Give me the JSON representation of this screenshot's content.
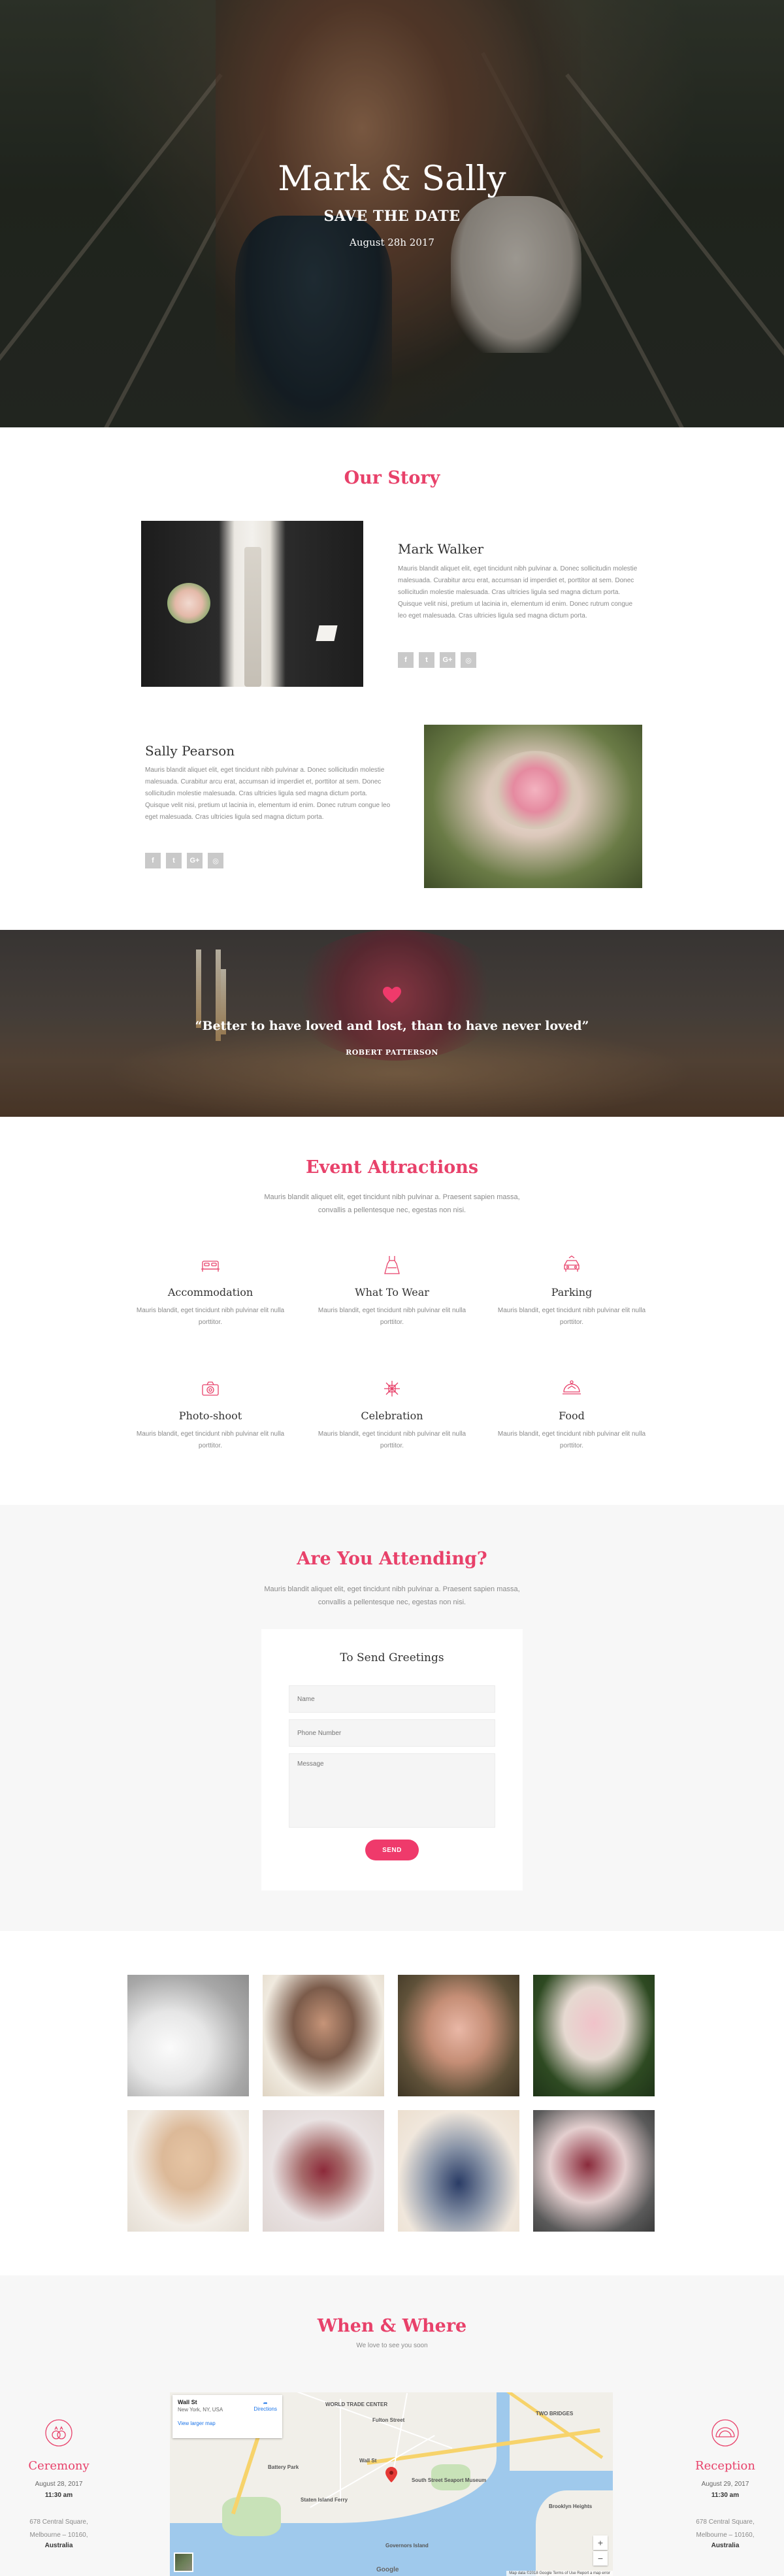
{
  "hero": {
    "names": "Mark & Sally",
    "subtitle": "SAVE THE DATE",
    "date": "August 28h 2017"
  },
  "story": {
    "title": "Our Story",
    "groom": {
      "name": "Mark Walker",
      "bio": "Mauris blandit aliquet elit, eget tincidunt nibh pulvinar a. Donec sollicitudin molestie malesuada. Curabitur arcu erat, accumsan id imperdiet et, porttitor at sem. Donec sollicitudin molestie malesuada. Cras ultricies ligula sed magna dictum porta. Quisque velit nisi, pretium ut lacinia in, elementum id enim. Donec rutrum congue leo eget malesuada. Cras ultricies ligula sed magna dictum porta."
    },
    "bride": {
      "name": "Sally Pearson",
      "bio": "Mauris blandit aliquet elit, eget tincidunt nibh pulvinar a. Donec sollicitudin molestie malesuada. Curabitur arcu erat, accumsan id imperdiet et, porttitor at sem. Donec sollicitudin molestie malesuada. Cras ultricies ligula sed magna dictum porta. Quisque velit nisi, pretium ut lacinia in, elementum id enim. Donec rutrum congue leo eget malesuada. Cras ultricies ligula sed magna dictum porta."
    },
    "social_icons": [
      "facebook-icon",
      "twitter-icon",
      "google-plus-icon",
      "instagram-icon"
    ],
    "social_glyphs": [
      "f",
      "t",
      "G+",
      "◎"
    ]
  },
  "quote": {
    "text": "“Better to have loved and lost, than to have never loved”",
    "author": "ROBERT PATTERSON"
  },
  "attractions": {
    "title": "Event Attractions",
    "description": "Mauris blandit aliquet elit, eget tincidunt nibh pulvinar a. Praesent sapien massa, convallis a pellentesque nec, egestas non nisi.",
    "items": [
      {
        "name": "Accommodation",
        "icon": "bed-icon",
        "desc": "Mauris blandit, eget tincidunt nibh pulvinar elit nulla porttitor."
      },
      {
        "name": "What To Wear",
        "icon": "dress-icon",
        "desc": "Mauris blandit, eget tincidunt nibh pulvinar elit nulla porttitor."
      },
      {
        "name": "Parking",
        "icon": "car-icon",
        "desc": "Mauris blandit, eget tincidunt nibh pulvinar elit nulla porttitor."
      },
      {
        "name": "Photo-shoot",
        "icon": "camera-icon",
        "desc": "Mauris blandit, eget tincidunt nibh pulvinar elit nulla porttitor."
      },
      {
        "name": "Celebration",
        "icon": "fireworks-icon",
        "desc": "Mauris blandit, eget tincidunt nibh pulvinar elit nulla porttitor."
      },
      {
        "name": "Food",
        "icon": "food-tray-icon",
        "desc": "Mauris blandit, eget tincidunt nibh pulvinar elit nulla porttitor."
      }
    ]
  },
  "rsvp": {
    "title": "Are You Attending?",
    "description": "Mauris blandit aliquet elit, eget tincidunt nibh pulvinar a. Praesent sapien massa, convallis a pellentesque nec, egestas non nisi.",
    "form_title": "To Send Greetings",
    "name_placeholder": "Name",
    "phone_placeholder": "Phone Number",
    "message_placeholder": "Message",
    "send_label": "SEND"
  },
  "when_where": {
    "title": "When & Where",
    "subtitle": "We love to see you soon",
    "ceremony": {
      "title": "Ceremony",
      "date": "August 28, 2017",
      "time": "11:30 am",
      "address_line1": "678 Central Square,",
      "address_line2": "Melbourne – 10160,",
      "country": "Australia"
    },
    "reception": {
      "title": "Reception",
      "date": "August 29, 2017",
      "time": "11:30 am",
      "address_line1": "678 Central Square,",
      "address_line2": "Melbourne – 10160,",
      "country": "Australia"
    },
    "map": {
      "place": "Wall St",
      "place_sub": "New York, NY, USA",
      "larger_map": "View larger map",
      "directions": "Directions",
      "labels": [
        "WORLD TRADE CENTER",
        "Fulton Street",
        "TWO BRIDGES",
        "Wall St",
        "South Street Seaport Museum",
        "Battery Park",
        "Brooklyn Heights",
        "Governors Island",
        "Staten Island Ferry"
      ],
      "footer": "Map data ©2018 Google   Terms of Use   Report a map error",
      "google": "Google"
    }
  },
  "colors": {
    "accent": "#e8416a",
    "button": "#ef3a6b"
  }
}
